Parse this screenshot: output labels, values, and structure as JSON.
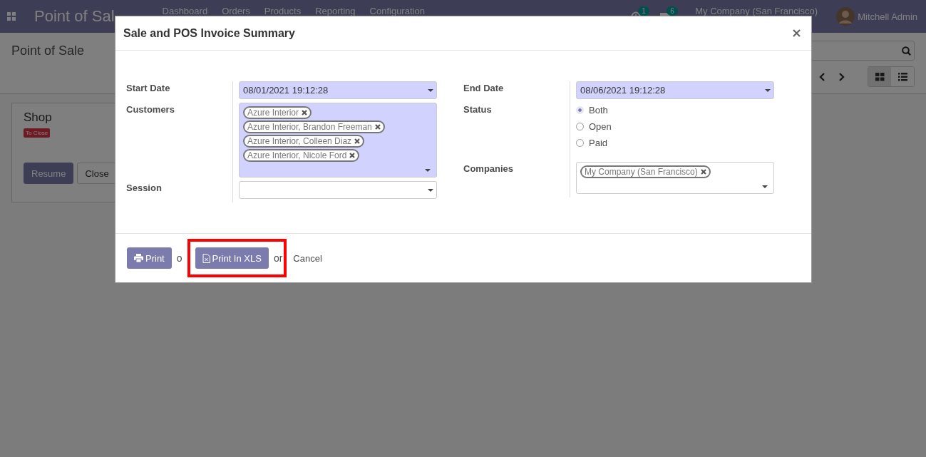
{
  "navbar": {
    "app_title": "Point of Sal",
    "menu": [
      "Dashboard",
      "Orders",
      "Products",
      "Reporting",
      "Configuration"
    ],
    "activity_count": "1",
    "message_count": "6",
    "company": "My Company (San Francisco)",
    "user": "Mitchell Admin"
  },
  "control_panel": {
    "breadcrumb": "Point of Sale",
    "views": [
      {
        "kind": "kanban",
        "selected": true
      },
      {
        "kind": "list",
        "selected": false
      }
    ]
  },
  "kanban_card": {
    "title": "Shop",
    "status_badge": "To Close",
    "buttons": [
      {
        "label": "Resume",
        "kind": "primary"
      },
      {
        "label": "Close",
        "kind": "secondary"
      }
    ]
  },
  "dialog": {
    "title": "Sale and POS Invoice Summary",
    "columns": [
      [
        {
          "kind": "date",
          "label": "Start Date",
          "value": "08/01/2021 19:12:28",
          "required": true
        },
        {
          "kind": "tags",
          "label": "Customers",
          "required": true,
          "tags": [
            "Azure Interior",
            "Azure Interior, Brandon Freeman",
            "Azure Interior, Colleen Diaz",
            "Azure Interior, Nicole Ford"
          ]
        },
        {
          "kind": "select",
          "label": "Session",
          "required": false
        }
      ],
      [
        {
          "kind": "date",
          "label": "End Date",
          "value": "08/06/2021 19:12:28",
          "required": true
        },
        {
          "kind": "radio",
          "label": "Status",
          "options": [
            {
              "label": "Both",
              "selected": true
            },
            {
              "label": "Open",
              "selected": false
            },
            {
              "label": "Paid",
              "selected": false
            }
          ]
        },
        {
          "kind": "tags",
          "label": "Companies",
          "required": false,
          "tags": [
            "My Company (San Francisco)"
          ]
        }
      ]
    ],
    "footer": [
      {
        "kind": "print",
        "label": "Print",
        "highlighted": false
      },
      {
        "kind": "text",
        "label": "o"
      },
      {
        "kind": "export",
        "label": "Print In XLS",
        "highlighted": true
      },
      {
        "kind": "text",
        "label": "or"
      },
      {
        "kind": "link",
        "label": "Cancel"
      }
    ]
  }
}
